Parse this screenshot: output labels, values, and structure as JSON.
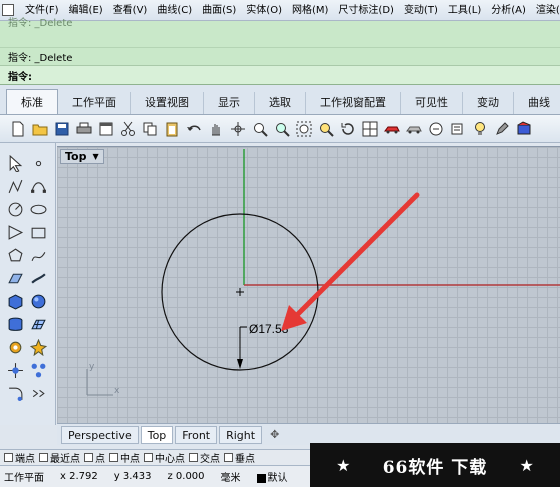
{
  "menubar": {
    "items": [
      "文件(F)",
      "编辑(E)",
      "查看(V)",
      "曲线(C)",
      "曲面(S)",
      "实体(O)",
      "网格(M)",
      "尺寸标注(D)",
      "变动(T)",
      "工具(L)",
      "分析(A)",
      "渲染(R)"
    ]
  },
  "command": {
    "ghost_line": "指令: _Delete",
    "history_line": "指令: _Delete",
    "prompt": "指令:"
  },
  "ribbon_tabs": [
    "标准",
    "工作平面",
    "设置视图",
    "显示",
    "选取",
    "工作视窗配置",
    "可见性",
    "变动",
    "曲线"
  ],
  "viewport": {
    "title": "Top",
    "dropdown_glyph": "▼",
    "dimension_label": "Ø17.58",
    "axis_y": "y",
    "axis_x": "x",
    "colors": {
      "circle": "#000000",
      "x_axis": "#b23a3a",
      "y_axis": "#2e9e3a",
      "arrow": "#e53935"
    }
  },
  "view_tabs": [
    "Perspective",
    "Top",
    "Front",
    "Right",
    "✥"
  ],
  "osnaps": [
    "端点",
    "最近点",
    "点",
    "中点",
    "中心点",
    "交点",
    "垂点"
  ],
  "status": {
    "cplane": "工作平面",
    "x": "x 2.792",
    "y": "y 3.433",
    "z": "z 0.000",
    "unit": "毫米",
    "layer": "默认"
  },
  "watermark": {
    "text": "66软件 下载",
    "star": "★"
  }
}
